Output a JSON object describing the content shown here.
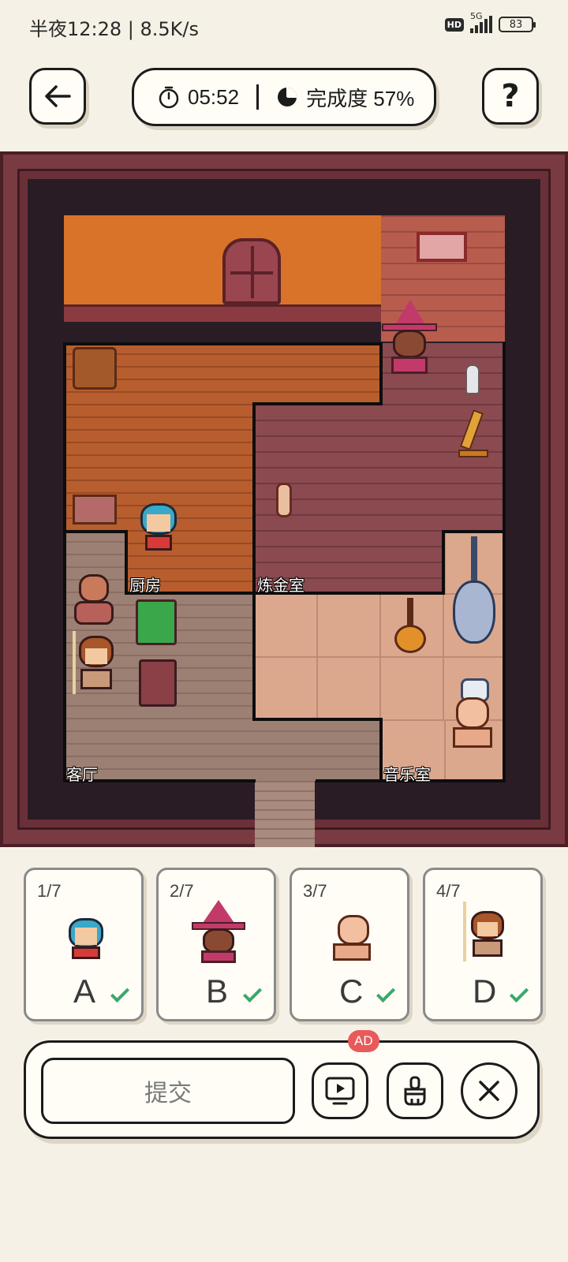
{
  "status_bar": {
    "text": "半夜12:28 | 8.5K/s",
    "hd": "HD",
    "network": "5G",
    "battery": "83"
  },
  "top_bar": {
    "timer": "05:52",
    "progress": "完成度 57%",
    "progress_value": 0.57,
    "help": "?"
  },
  "map": {
    "rooms": {
      "kitchen": "厨房",
      "alchemy": "炼金室",
      "living": "客厅",
      "music": "音乐室"
    }
  },
  "cards": [
    {
      "index": "1/7",
      "letter": "A",
      "done": true
    },
    {
      "index": "2/7",
      "letter": "B",
      "done": true
    },
    {
      "index": "3/7",
      "letter": "C",
      "done": true
    },
    {
      "index": "4/7",
      "letter": "D",
      "done": true
    }
  ],
  "actions": {
    "submit": "提交",
    "ad_badge": "AD"
  },
  "colors": {
    "background": "#f6f1e6",
    "accent_check": "#3aa86a",
    "ad_badge": "#e85a5a",
    "frame": "#7a3a42"
  }
}
